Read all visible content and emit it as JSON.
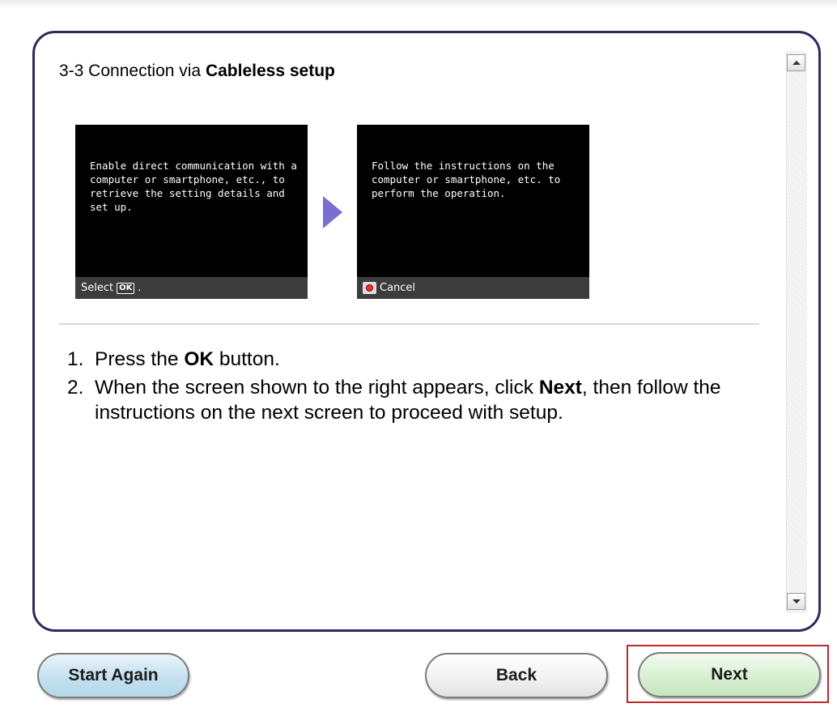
{
  "panel": {
    "title_prefix": "3-3 Connection via ",
    "title_bold": "Cableless setup",
    "screens": [
      {
        "text": "Enable direct communication with a computer or smartphone, etc., to retrieve the setting details and set up.",
        "footer_label": "Select",
        "footer_key": "OK",
        "footer_suffix": "."
      },
      {
        "text": "Follow the instructions on the computer or smartphone, etc. to perform the operation.",
        "footer_icon": "stop-icon",
        "footer_label": "Cancel"
      }
    ],
    "steps": [
      {
        "num": "1.",
        "text_before": "Press the ",
        "bold": "OK",
        "text_after": " button."
      },
      {
        "num": "2.",
        "text_before": "When the screen shown to the right appears, click ",
        "bold": "Next",
        "text_after": ", then follow the instructions on the next screen to proceed with setup."
      }
    ]
  },
  "buttons": {
    "start_again": "Start Again",
    "back": "Back",
    "next": "Next"
  },
  "colors": {
    "panel_border": "#2e2a5c",
    "arrow": "#7a6ed0",
    "highlight_border": "#c0262e",
    "start_button": "#c4e0ef",
    "next_button": "#d8f0d2"
  }
}
